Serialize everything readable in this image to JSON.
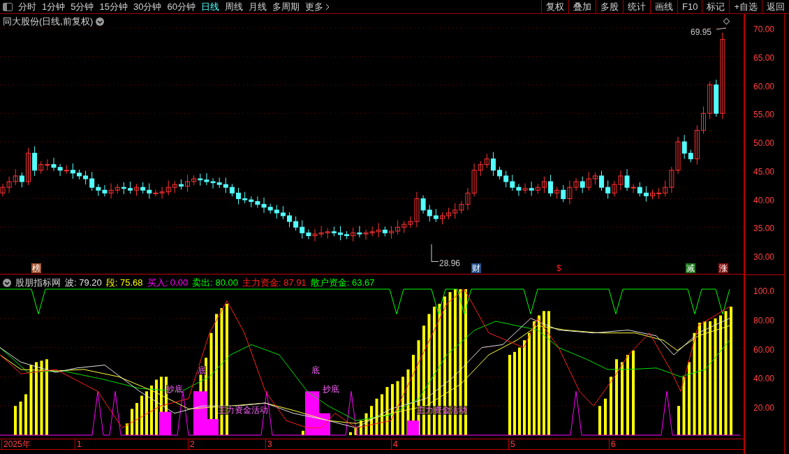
{
  "toolbar": {
    "periods": [
      {
        "label": "分时",
        "selected": false
      },
      {
        "label": "1分钟",
        "selected": false
      },
      {
        "label": "5分钟",
        "selected": false
      },
      {
        "label": "15分钟",
        "selected": false
      },
      {
        "label": "30分钟",
        "selected": false
      },
      {
        "label": "60分钟",
        "selected": false
      },
      {
        "label": "日线",
        "selected": true
      },
      {
        "label": "周线",
        "selected": false
      },
      {
        "label": "月线",
        "selected": false
      },
      {
        "label": "多周期",
        "selected": false
      },
      {
        "label": "更多",
        "selected": false
      }
    ],
    "buttons": [
      "复权",
      "叠加",
      "多股",
      "统计",
      "画线",
      "F10",
      "标记",
      "+自选",
      "返回"
    ]
  },
  "price_chart": {
    "title": "同大股份(日线,前复权)",
    "high_label": "69.95",
    "low_label": "28.96",
    "markers": [
      {
        "text": "榜",
        "color": "#a0522d"
      },
      {
        "text": "财",
        "color": "#1e4f8a"
      },
      {
        "text": "$",
        "color": "#000000"
      },
      {
        "text": "减",
        "color": "#1f7a1f"
      },
      {
        "text": "涨",
        "color": "#8b1010"
      }
    ],
    "y_ticks": [
      "70.00",
      "65.00",
      "60.00",
      "55.00",
      "50.00",
      "45.00",
      "40.00",
      "35.00",
      "30.00"
    ]
  },
  "indicator": {
    "name": "股朋指标网",
    "readouts": [
      {
        "label": "波:",
        "value": "79.20",
        "color": "#e6e6e6"
      },
      {
        "label": "段:",
        "value": "75.68",
        "color": "#ffff00"
      },
      {
        "label": "买入:",
        "value": "0.00",
        "color": "#ff00ff"
      },
      {
        "label": "卖出:",
        "value": "80.00",
        "color": "#00ff00"
      },
      {
        "label": "主力资金:",
        "value": "87.91",
        "color": "#ff2020"
      },
      {
        "label": "散户资金:",
        "value": "63.67",
        "color": "#00ff00"
      }
    ],
    "annotations": [
      "抄底",
      "底",
      "主力资金活动",
      "底",
      "抄底",
      "主力资金活动"
    ],
    "y_ticks": [
      "100.0",
      "80.00",
      "60.00",
      "40.00",
      "20.00"
    ]
  },
  "date_axis": [
    "2025年",
    "1",
    "2",
    "3",
    "4",
    "5",
    "6"
  ]
}
